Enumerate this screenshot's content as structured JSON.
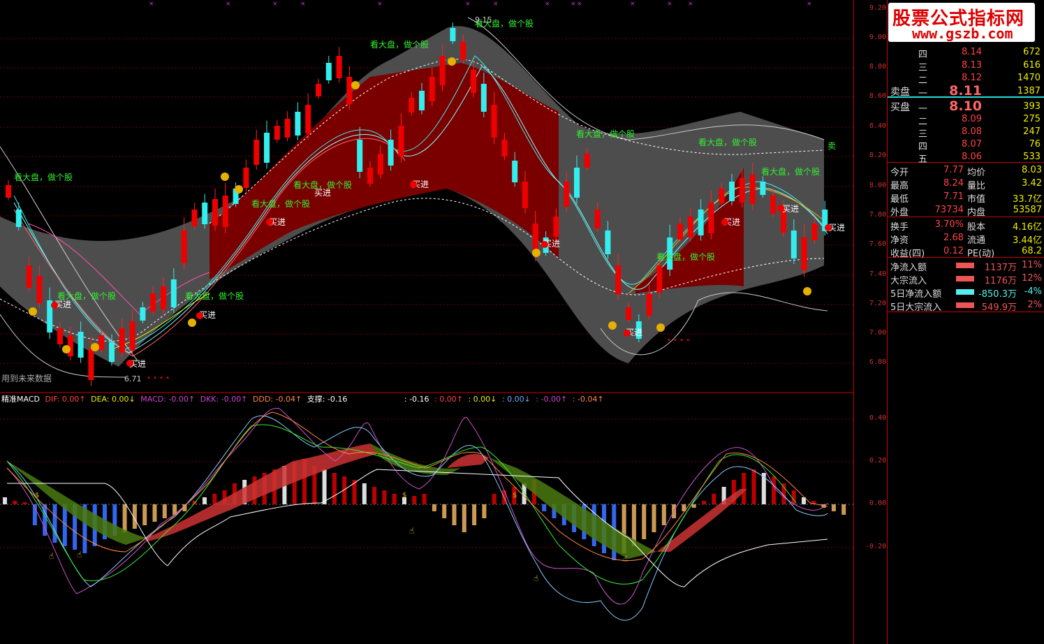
{
  "logo": {
    "line1": "股票公式指标网",
    "line2": "www.gszb.com"
  },
  "price_axis": [
    "9.20",
    "9.00",
    "8.80",
    "8.60",
    "8.40",
    "8.20",
    "8.00",
    "7.80",
    "7.60",
    "7.40",
    "7.20",
    "7.00",
    "6.80"
  ],
  "macd_axis": [
    "0.40",
    "0.20",
    "0.00",
    "-0.20"
  ],
  "annotations": {
    "future_data": "用到未来数据",
    "buy": "买进",
    "follow": "看大盘，做个股",
    "low_label": "6.71",
    "high_label": "9.15",
    "sell": "卖"
  },
  "macd_legend": {
    "name": "精准MACD",
    "dif": "DIF: 0.00↑",
    "dea": "DEA: 0.00↓",
    "macd": "MACD: -0.00↑",
    "dkk": "DKK: -0.00↑",
    "ddd": "DDD: -0.04↑",
    "support": "支撑: -0.16",
    "v1": ": -0.16",
    "v2": ": 0.00↑",
    "v3": ": 0.00↓",
    "v4": ": 0.00↓",
    "v5": ": -0.00↑",
    "v6": ": -0.04↑"
  },
  "orderbook": {
    "sell_label": "卖盘",
    "buy_label": "买盘",
    "asks": [
      {
        "level": "四",
        "price": "8.14",
        "vol": "672"
      },
      {
        "level": "三",
        "price": "8.13",
        "vol": "616"
      },
      {
        "level": "二",
        "price": "8.12",
        "vol": "1470"
      },
      {
        "level": "一",
        "price": "8.11",
        "vol": "1387"
      }
    ],
    "bids": [
      {
        "level": "一",
        "price": "8.10",
        "vol": "393"
      },
      {
        "level": "二",
        "price": "8.09",
        "vol": "275"
      },
      {
        "level": "三",
        "price": "8.08",
        "vol": "247"
      },
      {
        "level": "四",
        "price": "8.07",
        "vol": "76"
      },
      {
        "level": "五",
        "price": "8.06",
        "vol": "533"
      }
    ]
  },
  "stats": [
    [
      "今开",
      "7.77",
      "均价",
      "8.03"
    ],
    [
      "最高",
      "8.24",
      "量比",
      "3.42"
    ],
    [
      "最低",
      "7.71",
      "市值",
      "33.7亿"
    ],
    [
      "外盘",
      "73734",
      "内盘",
      "53587"
    ],
    [
      "换手",
      "3.70%",
      "股本",
      "4.16亿"
    ],
    [
      "净资",
      "2.68",
      "流通",
      "3.44亿"
    ],
    [
      "收益(四)",
      "0.12",
      "PE(动)",
      "68.2"
    ]
  ],
  "flows": [
    {
      "label": "净流入额",
      "value": "1137万",
      "pct": "11%",
      "color": "#e55"
    },
    {
      "label": "大宗流入",
      "value": "1176万",
      "pct": "12%",
      "color": "#e55"
    },
    {
      "label": "5日净流入额",
      "value": "-850.3万",
      "pct": "-4%",
      "color": "#5ee"
    },
    {
      "label": "5日大宗流入",
      "value": "549.9万",
      "pct": "2%",
      "color": "#e55"
    }
  ]
}
